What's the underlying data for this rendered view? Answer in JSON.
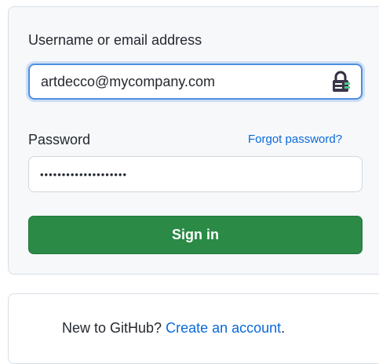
{
  "login_form": {
    "username_label": "Username or email address",
    "username_value": "artdecco@mycompany.com",
    "password_label": "Password",
    "forgot_password_link": "Forgot password?",
    "password_value": "••••••••••••••••••••",
    "sign_in_button": "Sign in",
    "password_manager_icon": "password-manager-icon"
  },
  "signup_box": {
    "prompt_text": "New to GitHub?",
    "create_account_link": "Create an account",
    "trailing_punctuation": "."
  },
  "colors": {
    "accent_green": "#2a8a46",
    "link_blue": "#0969da",
    "focus_border": "#4d8fe0",
    "panel_background": "#f6f8fa"
  }
}
